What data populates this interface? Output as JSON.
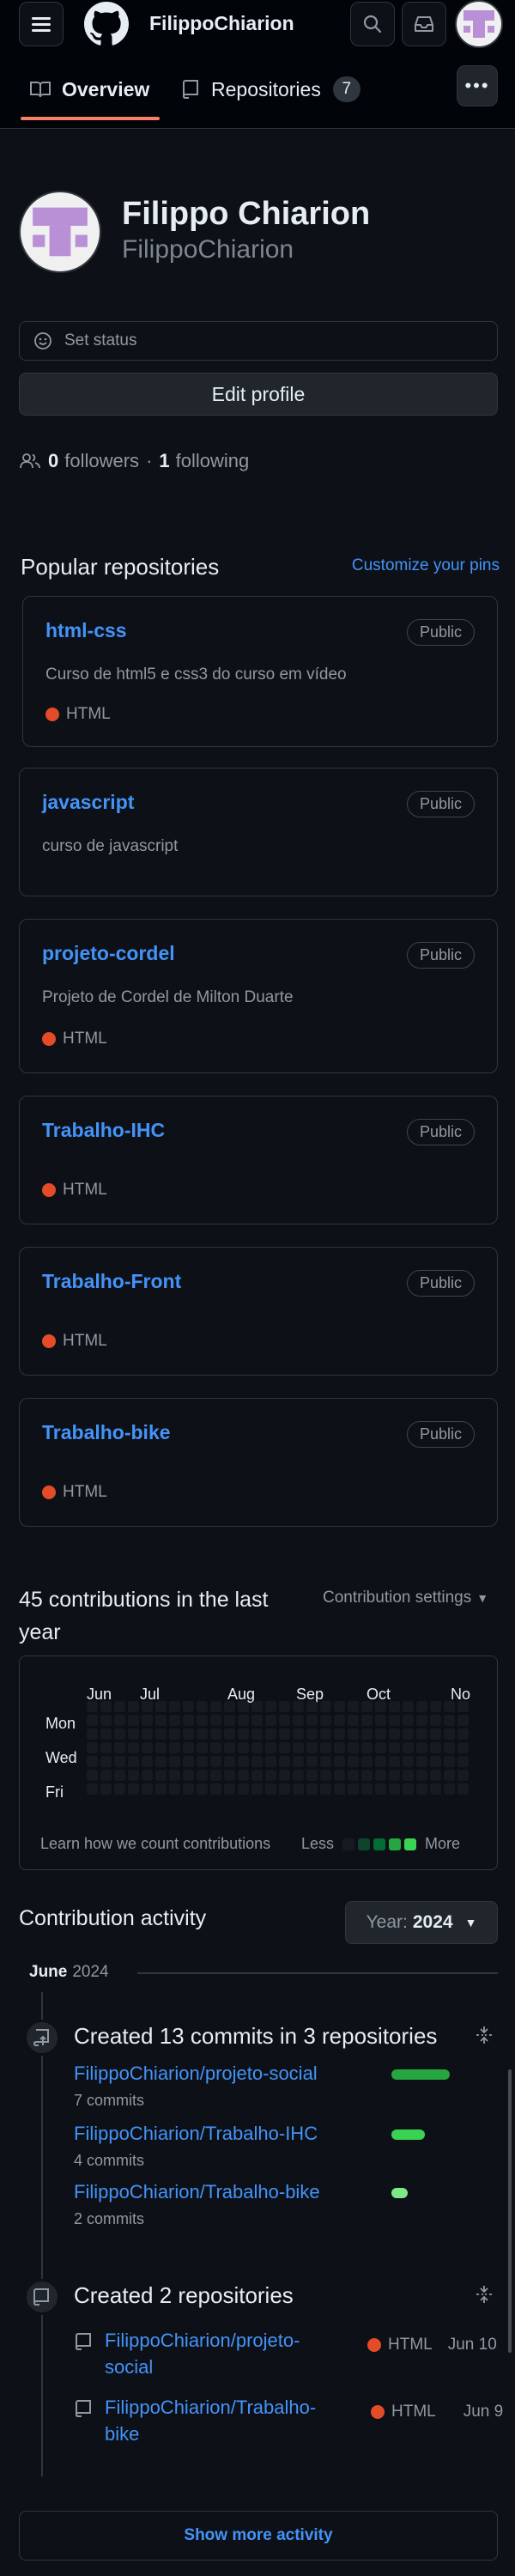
{
  "header": {
    "username": "FilippoChiarion",
    "tabs": [
      {
        "label": "Overview"
      },
      {
        "label": "Repositories",
        "count": "7"
      }
    ]
  },
  "profile": {
    "name": "Filippo Chiarion",
    "login": "FilippoChiarion",
    "set_status": "Set status",
    "edit_profile": "Edit profile",
    "followers_count": "0",
    "followers_label": "followers",
    "separator": "·",
    "following_count": "1",
    "following_label": "following"
  },
  "popular": {
    "title": "Popular repositories",
    "customize": "Customize your pins",
    "repos": [
      {
        "name": "html-css",
        "visibility": "Public",
        "description": "Curso de html5 e css3 do curso em vídeo",
        "language": "HTML"
      },
      {
        "name": "javascript",
        "visibility": "Public",
        "description": "curso de javascript"
      },
      {
        "name": "projeto-cordel",
        "visibility": "Public",
        "description": "Projeto de Cordel de Milton Duarte",
        "language": "HTML"
      },
      {
        "name": "Trabalho-IHC",
        "visibility": "Public",
        "language": "HTML"
      },
      {
        "name": "Trabalho-Front",
        "visibility": "Public",
        "language": "HTML"
      },
      {
        "name": "Trabalho-bike",
        "visibility": "Public",
        "language": "HTML"
      }
    ],
    "html_color": "#e34c26"
  },
  "contributions": {
    "title_line1": "45 contributions in the last",
    "title_line2": "year",
    "settings": "Contribution settings",
    "months": [
      "Jun",
      "Jul",
      "Aug",
      "Sep",
      "Oct",
      "No"
    ],
    "days": [
      "Mon",
      "Wed",
      "Fri"
    ],
    "learn": "Learn how we count contributions",
    "less": "Less",
    "more": "More",
    "legend_colors": [
      "#161b22",
      "#0e4429",
      "#006d32",
      "#26a641",
      "#39d353"
    ]
  },
  "activity": {
    "title": "Contribution activity",
    "year_label": "Year:",
    "year_value": "2024",
    "month": "June",
    "month_year": "2024",
    "commits": {
      "title": "Created 13 commits in 3 repositories",
      "repos": [
        {
          "name": "FilippoChiarion/projeto-social",
          "commits": "7 commits",
          "fraction": 0.54
        },
        {
          "name": "FilippoChiarion/Trabalho-IHC",
          "commits": "4 commits",
          "fraction": 0.31
        },
        {
          "name": "FilippoChiarion/Trabalho-bike",
          "commits": "2 commits",
          "fraction": 0.15
        }
      ]
    },
    "created": {
      "title": "Created 2 repositories",
      "repos": [
        {
          "line1": "FilippoChiarion/projeto-",
          "line2": "social",
          "language": "HTML",
          "date": "Jun 10"
        },
        {
          "line1": "FilippoChiarion/Trabalho-",
          "line2": "bike",
          "language": "HTML",
          "date": "Jun 9"
        }
      ]
    },
    "show_more": "Show more activity"
  },
  "colors": {
    "accent_link": "#4493f8",
    "tab_underline": "#f78166",
    "avatar": "#b98fd6"
  }
}
